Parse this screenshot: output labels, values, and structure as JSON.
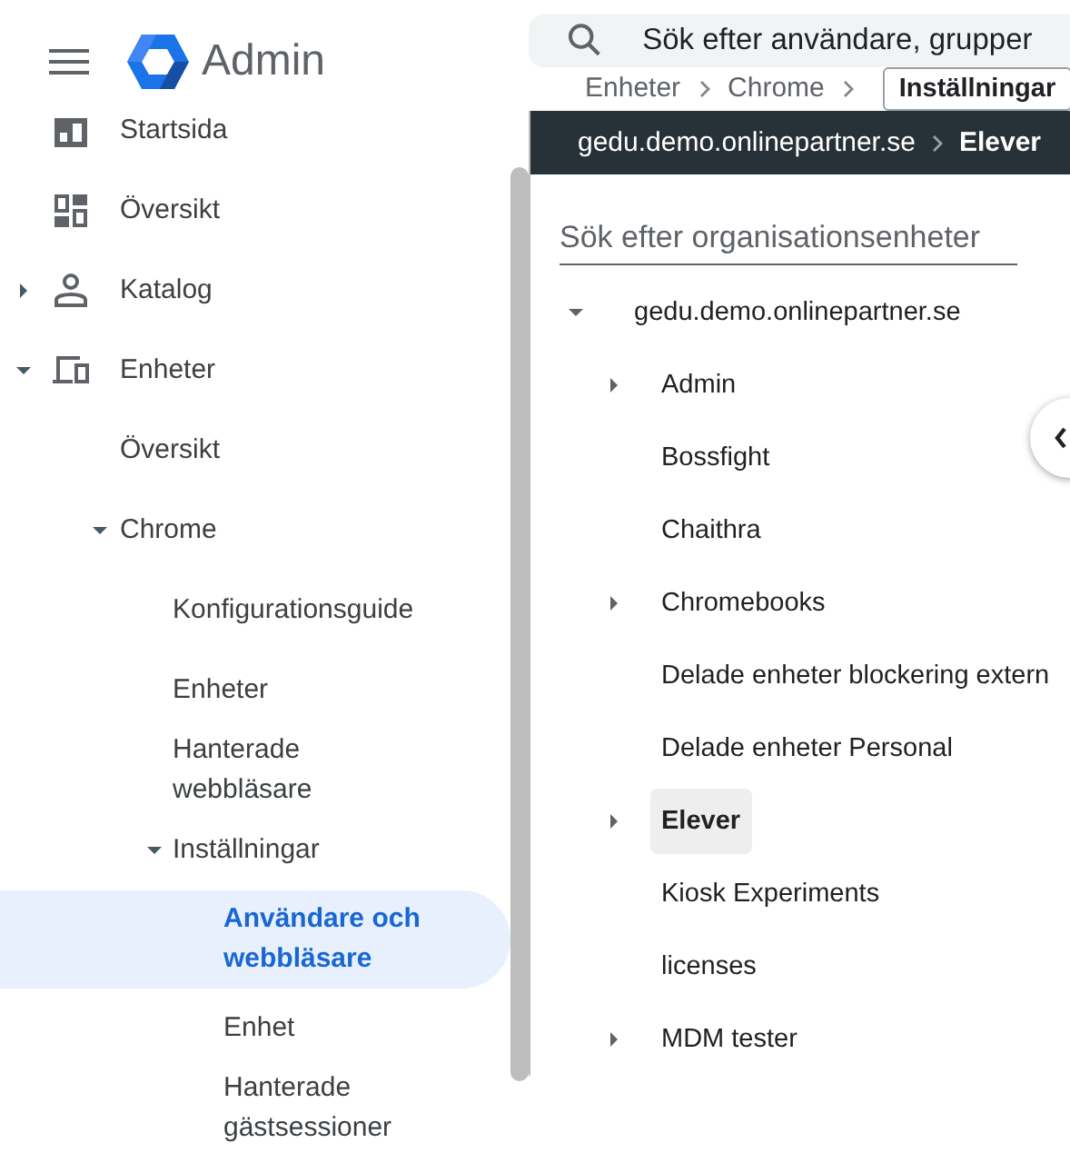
{
  "header": {
    "title": "Admin"
  },
  "search": {
    "placeholder": "Sök efter användare, grupper"
  },
  "sidebar": {
    "items": [
      {
        "label": "Startsida",
        "selected": false
      },
      {
        "label": "Översikt",
        "selected": false
      },
      {
        "label": "Katalog",
        "selected": false,
        "expanded": false
      },
      {
        "label": "Enheter",
        "selected": false,
        "expanded": true,
        "children": [
          {
            "label": "Översikt",
            "selected": false
          },
          {
            "label": "Chrome",
            "selected": false,
            "expanded": true,
            "children": [
              {
                "label": "Konfigurationsguide",
                "selected": false
              },
              {
                "label": "Enheter",
                "selected": false
              },
              {
                "label": "Hanterade webbläsare",
                "selected": false
              },
              {
                "label": "Inställningar",
                "selected": false,
                "expanded": true,
                "children": [
                  {
                    "label": "Användare och webbläsare",
                    "selected": true
                  },
                  {
                    "label": "Enhet",
                    "selected": false
                  },
                  {
                    "label": "Hanterade gästsessioner",
                    "selected": false
                  }
                ]
              }
            ]
          }
        ]
      }
    ]
  },
  "breadcrumb": [
    {
      "label": "Enheter",
      "kind": "link"
    },
    {
      "label": "Chrome",
      "kind": "link"
    },
    {
      "label": "Inställningar",
      "kind": "box"
    }
  ],
  "org_path": [
    "gedu.demo.onlinepartner.se",
    "Elever"
  ],
  "org_tree": {
    "search": {
      "placeholder": "Sök efter organisationsenheter"
    },
    "root": {
      "label": "gedu.demo.onlinepartner.se",
      "expanded": true,
      "selected": false,
      "children": [
        {
          "label": "Admin",
          "expanded": false,
          "selected": false
        },
        {
          "label": "Bossfight",
          "selected": false
        },
        {
          "label": "Chaithra",
          "selected": false
        },
        {
          "label": "Chromebooks",
          "expanded": false,
          "selected": false
        },
        {
          "label": "Delade enheter blockering extern",
          "selected": false
        },
        {
          "label": "Delade enheter Personal",
          "selected": false
        },
        {
          "label": "Elever",
          "expanded": false,
          "selected": true
        },
        {
          "label": "Kiosk Experiments",
          "selected": false
        },
        {
          "label": "licenses",
          "selected": false
        },
        {
          "label": "MDM tester",
          "expanded": false,
          "selected": false
        }
      ]
    }
  }
}
